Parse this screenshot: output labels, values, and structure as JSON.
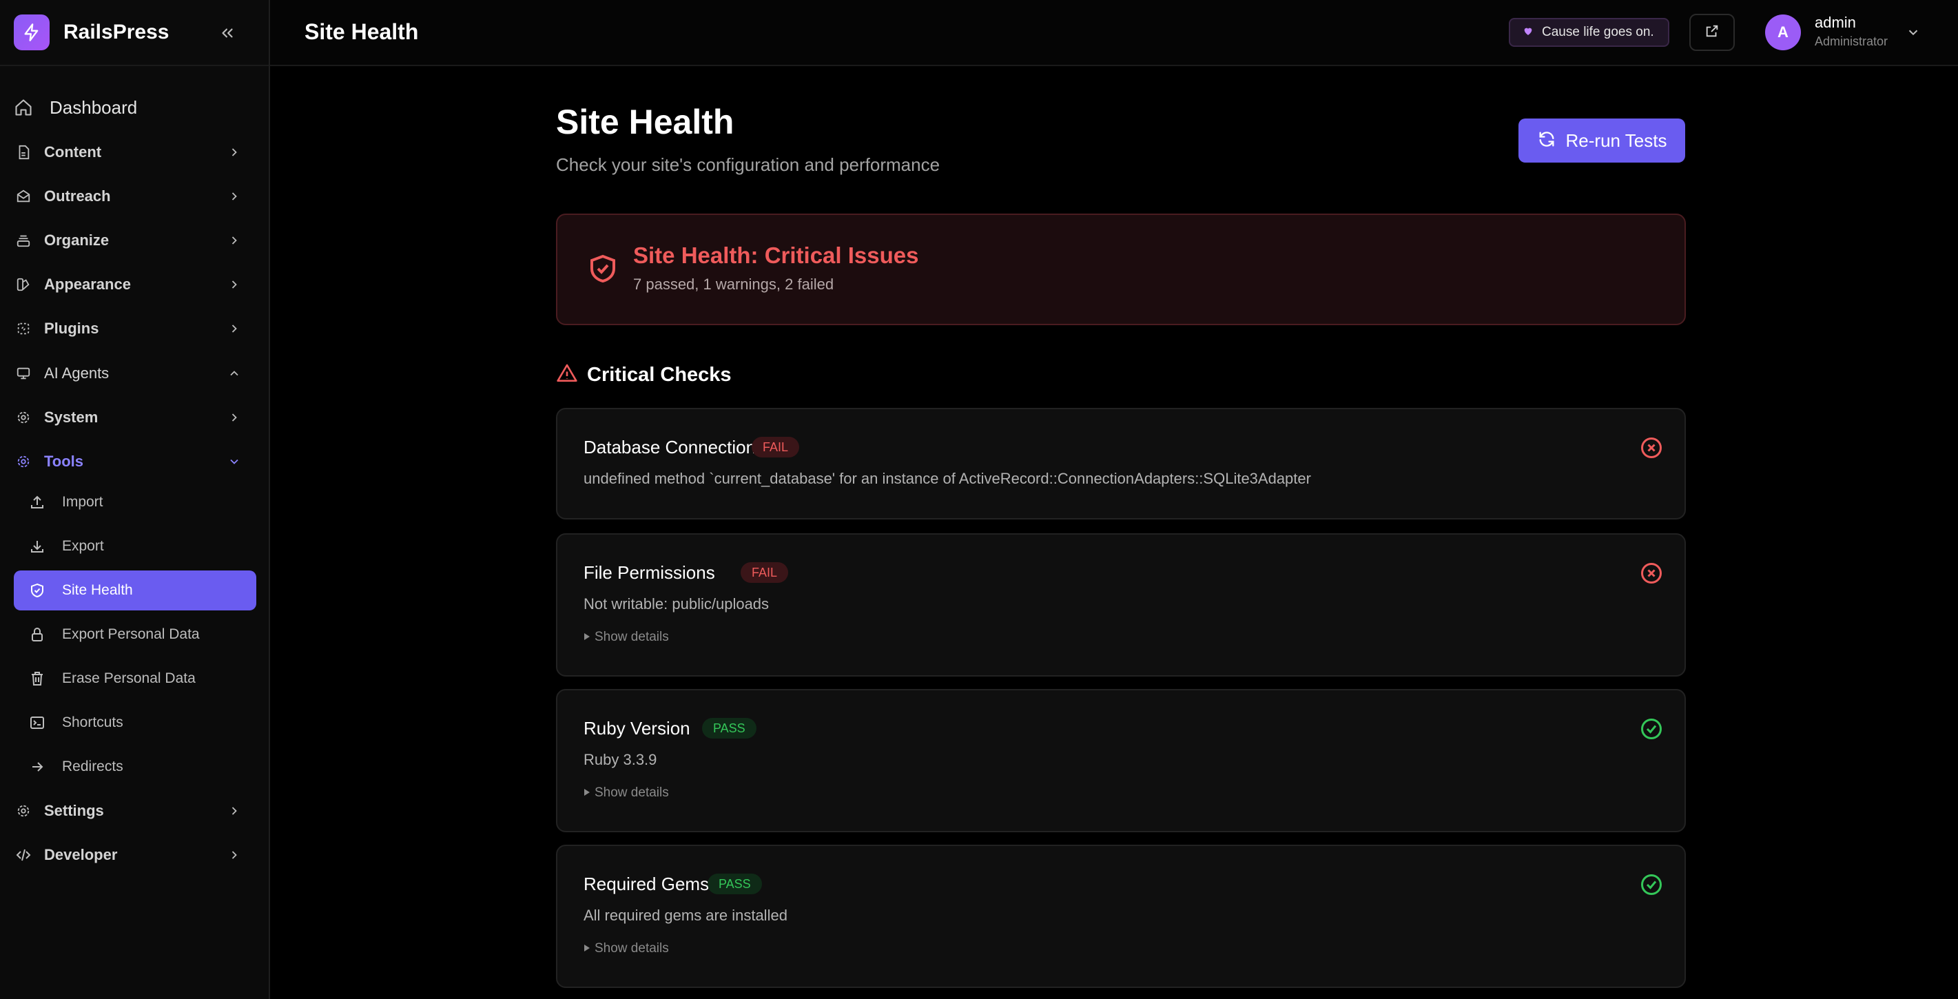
{
  "brand": {
    "name": "RailsPress"
  },
  "sidebar": {
    "dashboard": "Dashboard",
    "items": [
      {
        "label": "Content",
        "icon": "document-icon"
      },
      {
        "label": "Outreach",
        "icon": "mail-open-icon"
      },
      {
        "label": "Organize",
        "icon": "stack-icon"
      },
      {
        "label": "Appearance",
        "icon": "paint-icon"
      },
      {
        "label": "Plugins",
        "icon": "puzzle-icon"
      },
      {
        "label": "AI Agents",
        "icon": "monitor-icon"
      },
      {
        "label": "System",
        "icon": "gear-icon"
      },
      {
        "label": "Tools",
        "icon": "gear-icon"
      },
      {
        "label": "Settings",
        "icon": "gear-icon"
      },
      {
        "label": "Developer",
        "icon": "code-icon"
      }
    ],
    "tools_sub": [
      {
        "label": "Import",
        "icon": "upload-icon"
      },
      {
        "label": "Export",
        "icon": "download-icon"
      },
      {
        "label": "Site Health",
        "icon": "shield-icon"
      },
      {
        "label": "Export Personal Data",
        "icon": "lock-icon"
      },
      {
        "label": "Erase Personal Data",
        "icon": "trash-icon"
      },
      {
        "label": "Shortcuts",
        "icon": "terminal-icon"
      },
      {
        "label": "Redirects",
        "icon": "arrow-right-icon"
      }
    ]
  },
  "header": {
    "title": "Site Health",
    "motto": "Cause life goes on.",
    "user": {
      "initial": "A",
      "name": "admin",
      "role": "Administrator"
    }
  },
  "page": {
    "title": "Site Health",
    "subtitle": "Check your site's configuration and performance",
    "rerun_label": "Re-run Tests",
    "status": {
      "title": "Site Health: Critical Issues",
      "summary": "7 passed, 1 warnings, 2 failed"
    },
    "section_title": "Critical Checks",
    "checks": [
      {
        "name": "Database Connection",
        "badge": "FAIL",
        "message": "undefined method `current_database' for an instance of ActiveRecord::ConnectionAdapters::SQLite3Adapter",
        "details": ""
      },
      {
        "name": "File Permissions",
        "badge": "FAIL",
        "message": "Not writable: public/uploads",
        "details": "Show details"
      },
      {
        "name": "Ruby Version",
        "badge": "PASS",
        "message": "Ruby 3.3.9",
        "details": "Show details"
      },
      {
        "name": "Required Gems",
        "badge": "PASS",
        "message": "All required gems are installed",
        "details": "Show details"
      }
    ]
  },
  "colors": {
    "accent": "#6a5cf0",
    "fail": "#ef5b5b",
    "pass": "#34c759",
    "active_text": "#8b83ff"
  }
}
